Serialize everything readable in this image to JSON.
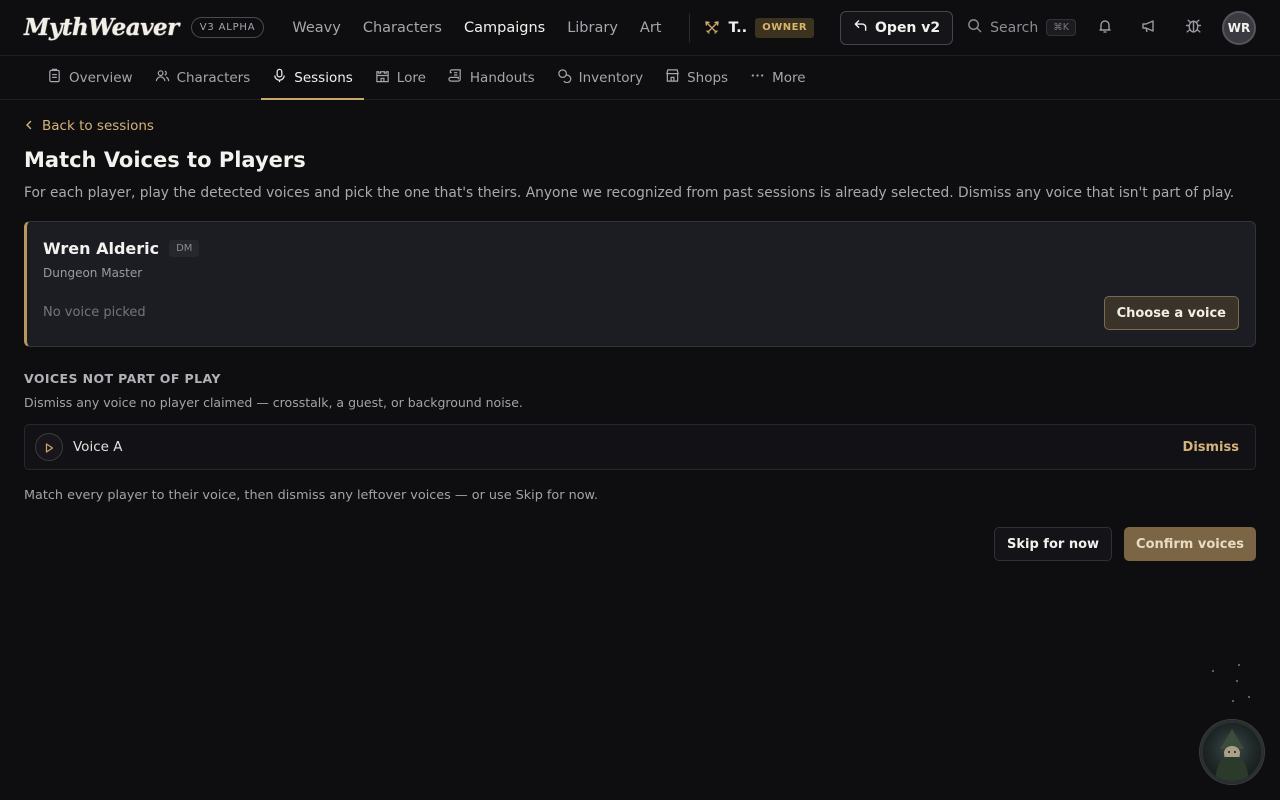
{
  "brand": {
    "logo": "MythWeaver",
    "version_badge": "V3 ALPHA"
  },
  "main_nav": [
    {
      "label": "Weavy",
      "active": false
    },
    {
      "label": "Characters",
      "active": false
    },
    {
      "label": "Campaigns",
      "active": true
    },
    {
      "label": "Library",
      "active": false
    },
    {
      "label": "Art",
      "active": false
    }
  ],
  "campaign": {
    "name": "T..",
    "role_badge": "OWNER"
  },
  "top_actions": {
    "open_v2_label": "Open v2",
    "search_label": "Search",
    "search_shortcut": "⌘K",
    "avatar_initials": "WR"
  },
  "sub_nav": [
    {
      "label": "Overview",
      "icon": "clipboard-icon",
      "active": false
    },
    {
      "label": "Characters",
      "icon": "users-icon",
      "active": false
    },
    {
      "label": "Sessions",
      "icon": "microphone-icon",
      "active": true
    },
    {
      "label": "Lore",
      "icon": "castle-icon",
      "active": false
    },
    {
      "label": "Handouts",
      "icon": "scroll-icon",
      "active": false
    },
    {
      "label": "Inventory",
      "icon": "coins-icon",
      "active": false
    },
    {
      "label": "Shops",
      "icon": "store-icon",
      "active": false
    },
    {
      "label": "More",
      "icon": "ellipsis-icon",
      "active": false
    }
  ],
  "page": {
    "back_link": "Back to sessions",
    "title": "Match Voices to Players",
    "description": "For each player, play the detected voices and pick the one that's theirs. Anyone we recognized from past sessions is already selected. Dismiss any voice that isn't part of play."
  },
  "player": {
    "name": "Wren Alderic",
    "badge": "DM",
    "role": "Dungeon Master",
    "voice_status": "No voice picked",
    "choose_label": "Choose a voice"
  },
  "not_part_of_play": {
    "title": "VOICES NOT PART OF PLAY",
    "description": "Dismiss any voice no player claimed — crosstalk, a guest, or background noise.",
    "voices": [
      {
        "label": "Voice A",
        "dismiss_label": "Dismiss"
      }
    ]
  },
  "footer": {
    "note": "Match every player to their voice, then dismiss any leftover voices — or use Skip for now.",
    "skip_label": "Skip for now",
    "confirm_label": "Confirm voices"
  },
  "colors": {
    "accent": "#c9a96a",
    "background": "#0e0e11",
    "card": "#1c1c23",
    "confirm": "#7b6544"
  }
}
